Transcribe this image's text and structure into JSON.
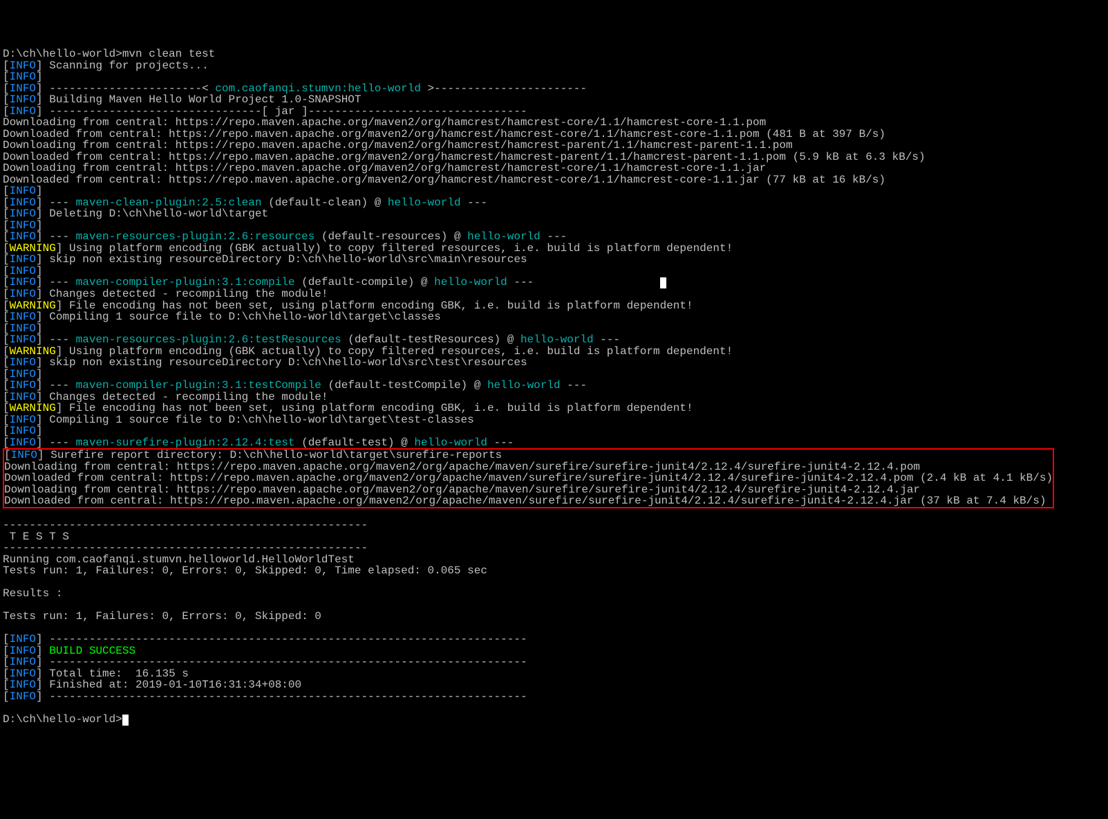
{
  "prompt_path": "D:\\ch\\hello-world>",
  "command": "mvn clean test",
  "scanning": "Scanning for projects...",
  "dashheader_pre": "-----------------------< ",
  "project_coord": "com.caofanqi.stumvn:hello-world",
  "dashheader_post": " >-----------------------",
  "building": "Building Maven Hello World Project 1.0-SNAPSHOT",
  "jar_line": "--------------------------------[ jar ]---------------------------------",
  "dl": {
    "l1": "Downloading from central: https://repo.maven.apache.org/maven2/org/hamcrest/hamcrest-core/1.1/hamcrest-core-1.1.pom",
    "l2": "Downloaded from central: https://repo.maven.apache.org/maven2/org/hamcrest/hamcrest-core/1.1/hamcrest-core-1.1.pom (481 B at 397 B/s)",
    "l3": "Downloading from central: https://repo.maven.apache.org/maven2/org/hamcrest/hamcrest-parent/1.1/hamcrest-parent-1.1.pom",
    "l4": "Downloaded from central: https://repo.maven.apache.org/maven2/org/hamcrest/hamcrest-parent/1.1/hamcrest-parent-1.1.pom (5.9 kB at 6.3 kB/s)",
    "l5": "Downloading from central: https://repo.maven.apache.org/maven2/org/hamcrest/hamcrest-core/1.1/hamcrest-core-1.1.jar",
    "l6": "Downloaded from central: https://repo.maven.apache.org/maven2/org/hamcrest/hamcrest-core/1.1/hamcrest-core-1.1.jar (77 kB at 16 kB/s)"
  },
  "plugin_sep": "--- ",
  "plugin_end": " ---",
  "clean_plugin": "maven-clean-plugin:2.5:clean",
  "clean_text": " (default-clean) @ ",
  "hello_world": "hello-world",
  "deleting": "Deleting D:\\ch\\hello-world\\target",
  "res_plugin_res": "maven-resources-plugin:2.6:resources",
  "res_text": " (default-resources) @ ",
  "warn_gbk": "Using platform encoding (GBK actually) to copy filtered resources, i.e. build is platform dependent!",
  "skip_main_res": "skip non existing resourceDirectory D:\\ch\\hello-world\\src\\main\\resources",
  "compiler_plugin": "maven-compiler-plugin:3.1:compile",
  "compile_text": " (default-compile) @ ",
  "changes": "Changes detected - recompiling the module!",
  "warn_enc": "File encoding has not been set, using platform encoding GBK, i.e. build is platform dependent!",
  "compiling_main": "Compiling 1 source file to D:\\ch\\hello-world\\target\\classes",
  "res_plugin_test": "maven-resources-plugin:2.6:testResources",
  "testres_text": " (default-testResources) @ ",
  "skip_test_res": "skip non existing resourceDirectory D:\\ch\\hello-world\\src\\test\\resources",
  "compiler_plugin_test": "maven-compiler-plugin:3.1:testCompile",
  "testcompile_text": " (default-testCompile) @ ",
  "compiling_test": "Compiling 1 source file to D:\\ch\\hello-world\\target\\test-classes",
  "surefire_plugin": "maven-surefire-plugin:2.12.4:test",
  "test_text": " (default-test) @ ",
  "surefire_report": "Surefire report directory: D:\\ch\\hello-world\\target\\surefire-reports",
  "sf": {
    "l1": "Downloading from central: https://repo.maven.apache.org/maven2/org/apache/maven/surefire/surefire-junit4/2.12.4/surefire-junit4-2.12.4.pom",
    "l2": "Downloaded from central: https://repo.maven.apache.org/maven2/org/apache/maven/surefire/surefire-junit4/2.12.4/surefire-junit4-2.12.4.pom (2.4 kB at 4.1 kB/s)",
    "l3": "Downloading from central: https://repo.maven.apache.org/maven2/org/apache/maven/surefire/surefire-junit4/2.12.4/surefire-junit4-2.12.4.jar",
    "l4": "Downloaded from central: https://repo.maven.apache.org/maven2/org/apache/maven/surefire/surefire-junit4/2.12.4/surefire-junit4-2.12.4.jar (37 kB at 7.4 kB/s)"
  },
  "tests_sep": "-------------------------------------------------------",
  "tests_header": " T E S T S",
  "running": "Running com.caofanqi.stumvn.helloworld.HelloWorldTest",
  "tests_run1": "Tests run: 1, Failures: 0, Errors: 0, Skipped: 0, Time elapsed: 0.065 sec",
  "results": "Results :",
  "tests_run2": "Tests run: 1, Failures: 0, Errors: 0, Skipped: 0",
  "long_sep": "------------------------------------------------------------------------",
  "build_success": "BUILD SUCCESS",
  "total_time": "Total time:  16.135 s",
  "finished_at": "Finished at: 2019-01-10T16:31:34+08:00",
  "prompt2": "D:\\ch\\hello-world>",
  "bracket_l": "[",
  "bracket_r": "]",
  "info_tag": "INFO",
  "warn_tag": "WARNING",
  "space": " "
}
